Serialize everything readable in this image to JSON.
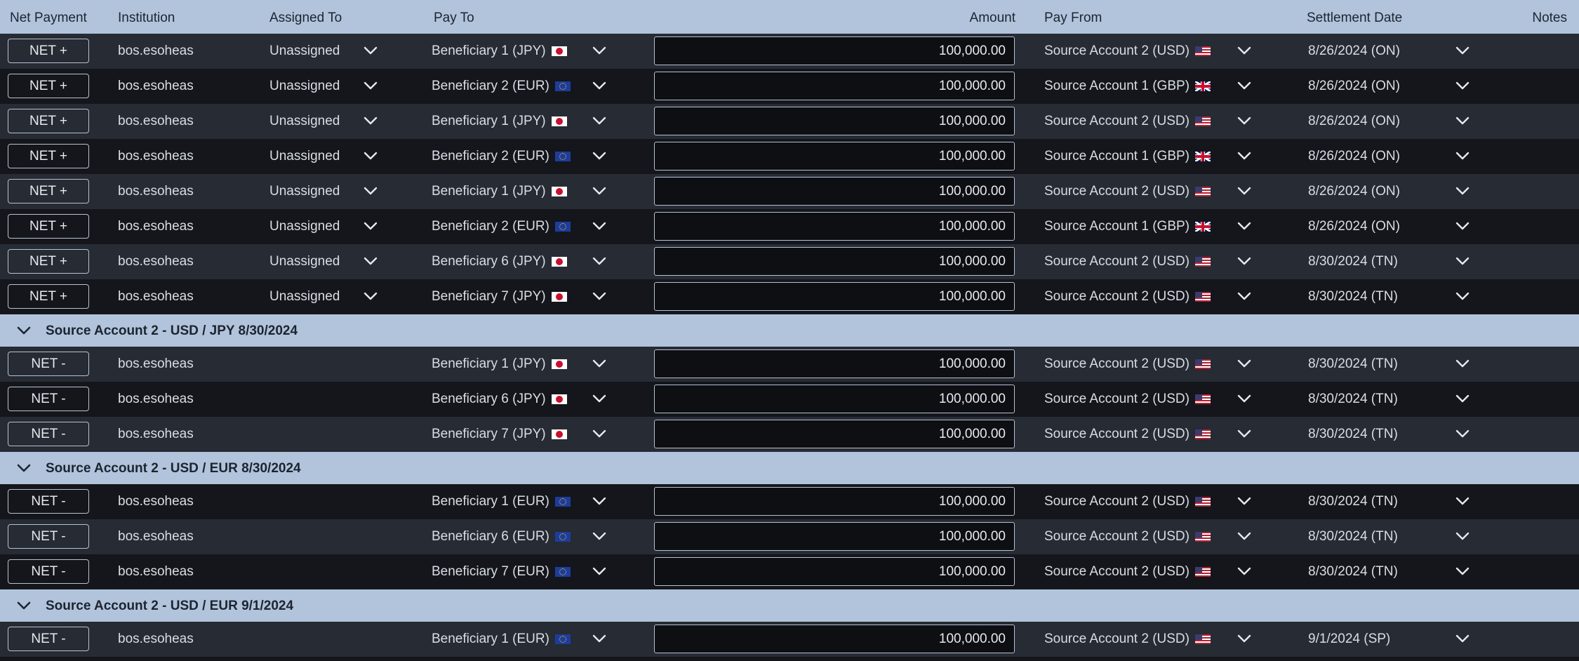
{
  "headers": {
    "net_payment": "Net Payment",
    "institution": "Institution",
    "assigned_to": "Assigned To",
    "pay_to": "Pay To",
    "amount": "Amount",
    "pay_from": "Pay From",
    "settlement_date": "Settlement Date",
    "notes": "Notes"
  },
  "colors": {
    "header_bg": "#b1c4dc",
    "row_odd": "#262b34",
    "row_even": "#14161b",
    "text": "#e6e9ef"
  },
  "icons": {
    "dropdown": "chevron-down-icon",
    "group_toggle": "chevron-down-icon",
    "flags": [
      "flag-jp-icon",
      "flag-eu-icon",
      "flag-us-icon",
      "flag-gb-icon"
    ]
  },
  "rows": [
    {
      "type": "data",
      "net": "NET +",
      "institution": "bos.esoheas",
      "assigned": "Unassigned",
      "pay_to": "Beneficiary 1 (JPY)",
      "pay_to_ccy": "JPY",
      "amount": "100,000.00",
      "pay_from": "Source Account 2 (USD)",
      "pay_from_ccy": "USD",
      "settlement": "8/26/2024 (ON)",
      "notes": ""
    },
    {
      "type": "data",
      "net": "NET +",
      "institution": "bos.esoheas",
      "assigned": "Unassigned",
      "pay_to": "Beneficiary 2 (EUR)",
      "pay_to_ccy": "EUR",
      "amount": "100,000.00",
      "pay_from": "Source Account 1 (GBP)",
      "pay_from_ccy": "GBP",
      "settlement": "8/26/2024 (ON)",
      "notes": ""
    },
    {
      "type": "data",
      "net": "NET +",
      "institution": "bos.esoheas",
      "assigned": "Unassigned",
      "pay_to": "Beneficiary 1 (JPY)",
      "pay_to_ccy": "JPY",
      "amount": "100,000.00",
      "pay_from": "Source Account 2 (USD)",
      "pay_from_ccy": "USD",
      "settlement": "8/26/2024 (ON)",
      "notes": ""
    },
    {
      "type": "data",
      "net": "NET +",
      "institution": "bos.esoheas",
      "assigned": "Unassigned",
      "pay_to": "Beneficiary 2 (EUR)",
      "pay_to_ccy": "EUR",
      "amount": "100,000.00",
      "pay_from": "Source Account 1 (GBP)",
      "pay_from_ccy": "GBP",
      "settlement": "8/26/2024 (ON)",
      "notes": ""
    },
    {
      "type": "data",
      "net": "NET +",
      "institution": "bos.esoheas",
      "assigned": "Unassigned",
      "pay_to": "Beneficiary 1 (JPY)",
      "pay_to_ccy": "JPY",
      "amount": "100,000.00",
      "pay_from": "Source Account 2 (USD)",
      "pay_from_ccy": "USD",
      "settlement": "8/26/2024 (ON)",
      "notes": ""
    },
    {
      "type": "data",
      "net": "NET +",
      "institution": "bos.esoheas",
      "assigned": "Unassigned",
      "pay_to": "Beneficiary 2 (EUR)",
      "pay_to_ccy": "EUR",
      "amount": "100,000.00",
      "pay_from": "Source Account 1 (GBP)",
      "pay_from_ccy": "GBP",
      "settlement": "8/26/2024 (ON)",
      "notes": ""
    },
    {
      "type": "data",
      "net": "NET +",
      "institution": "bos.esoheas",
      "assigned": "Unassigned",
      "pay_to": "Beneficiary 6 (JPY)",
      "pay_to_ccy": "JPY",
      "amount": "100,000.00",
      "pay_from": "Source Account 2 (USD)",
      "pay_from_ccy": "USD",
      "settlement": "8/30/2024 (TN)",
      "notes": ""
    },
    {
      "type": "data",
      "net": "NET +",
      "institution": "bos.esoheas",
      "assigned": "Unassigned",
      "pay_to": "Beneficiary 7 (JPY)",
      "pay_to_ccy": "JPY",
      "amount": "100,000.00",
      "pay_from": "Source Account 2 (USD)",
      "pay_from_ccy": "USD",
      "settlement": "8/30/2024 (TN)",
      "notes": ""
    },
    {
      "type": "group",
      "label": "Source Account 2 - USD / JPY 8/30/2024"
    },
    {
      "type": "data",
      "net": "NET -",
      "institution": "bos.esoheas",
      "assigned": "",
      "pay_to": "Beneficiary 1 (JPY)",
      "pay_to_ccy": "JPY",
      "amount": "100,000.00",
      "pay_from": "Source Account 2 (USD)",
      "pay_from_ccy": "USD",
      "settlement": "8/30/2024 (TN)",
      "notes": ""
    },
    {
      "type": "data",
      "net": "NET -",
      "institution": "bos.esoheas",
      "assigned": "",
      "pay_to": "Beneficiary 6 (JPY)",
      "pay_to_ccy": "JPY",
      "amount": "100,000.00",
      "pay_from": "Source Account 2 (USD)",
      "pay_from_ccy": "USD",
      "settlement": "8/30/2024 (TN)",
      "notes": ""
    },
    {
      "type": "data",
      "net": "NET -",
      "institution": "bos.esoheas",
      "assigned": "",
      "pay_to": "Beneficiary 7 (JPY)",
      "pay_to_ccy": "JPY",
      "amount": "100,000.00",
      "pay_from": "Source Account 2 (USD)",
      "pay_from_ccy": "USD",
      "settlement": "8/30/2024 (TN)",
      "notes": ""
    },
    {
      "type": "group",
      "label": "Source Account 2 - USD / EUR 8/30/2024"
    },
    {
      "type": "data",
      "net": "NET -",
      "institution": "bos.esoheas",
      "assigned": "",
      "pay_to": "Beneficiary 1 (EUR)",
      "pay_to_ccy": "EUR",
      "amount": "100,000.00",
      "pay_from": "Source Account 2 (USD)",
      "pay_from_ccy": "USD",
      "settlement": "8/30/2024 (TN)",
      "notes": ""
    },
    {
      "type": "data",
      "net": "NET -",
      "institution": "bos.esoheas",
      "assigned": "",
      "pay_to": "Beneficiary 6 (EUR)",
      "pay_to_ccy": "EUR",
      "amount": "100,000.00",
      "pay_from": "Source Account 2 (USD)",
      "pay_from_ccy": "USD",
      "settlement": "8/30/2024 (TN)",
      "notes": ""
    },
    {
      "type": "data",
      "net": "NET -",
      "institution": "bos.esoheas",
      "assigned": "",
      "pay_to": "Beneficiary 7 (EUR)",
      "pay_to_ccy": "EUR",
      "amount": "100,000.00",
      "pay_from": "Source Account 2 (USD)",
      "pay_from_ccy": "USD",
      "settlement": "8/30/2024 (TN)",
      "notes": ""
    },
    {
      "type": "group",
      "label": "Source Account 2 - USD / EUR 9/1/2024"
    },
    {
      "type": "data",
      "net": "NET -",
      "institution": "bos.esoheas",
      "assigned": "",
      "pay_to": "Beneficiary 1 (EUR)",
      "pay_to_ccy": "EUR",
      "amount": "100,000.00",
      "pay_from": "Source Account 2 (USD)",
      "pay_from_ccy": "USD",
      "settlement": "9/1/2024 (SP)",
      "notes": ""
    }
  ]
}
